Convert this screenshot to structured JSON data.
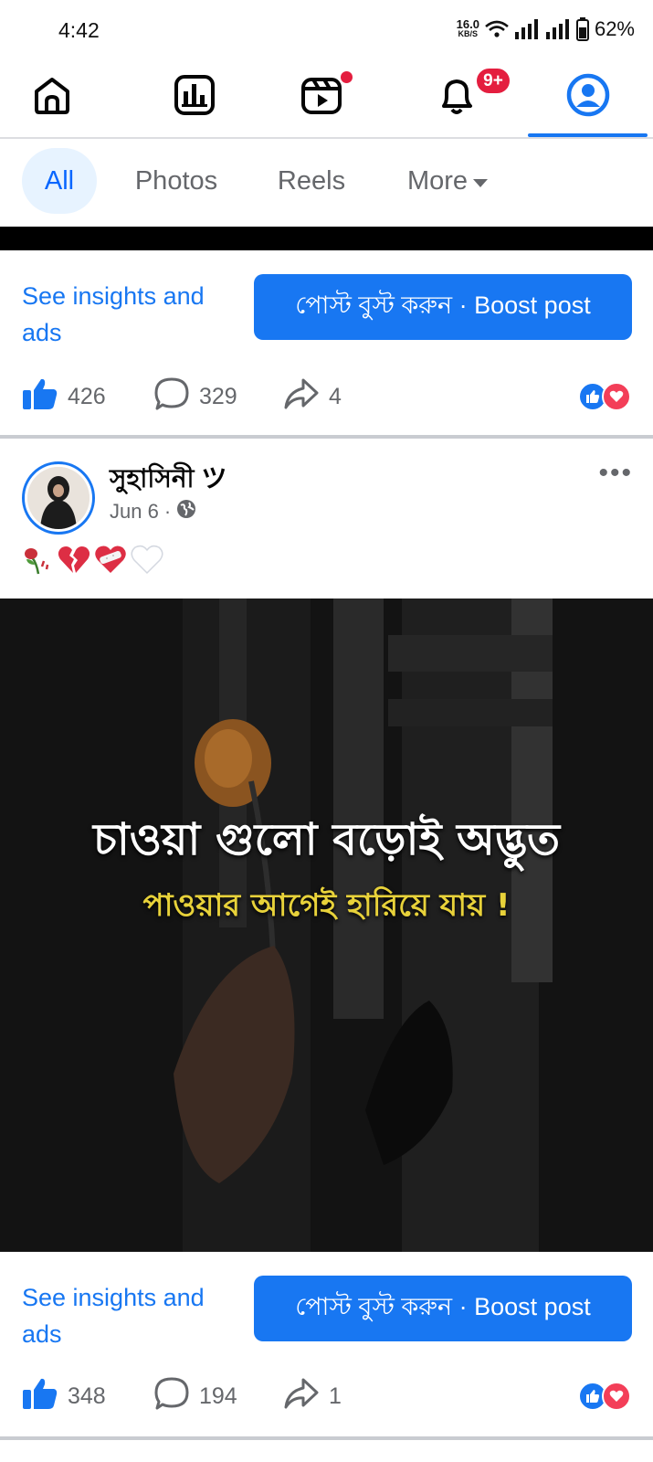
{
  "status_bar": {
    "time": "4:42",
    "net_speed_value": "16.0",
    "net_speed_unit": "KB/S",
    "battery_percent": "62%"
  },
  "top_nav": {
    "items": [
      "home-icon",
      "dashboard-icon",
      "video-icon",
      "notifications-icon",
      "profile-icon"
    ],
    "notification_badge": "9+",
    "active_item": "profile-icon",
    "accent_color": "#1877f2",
    "badge_color": "#e41e3f"
  },
  "filter_tabs": {
    "all": "All",
    "photos": "Photos",
    "reels": "Reels",
    "more": "More"
  },
  "post1": {
    "insights_link": "See insights and ads",
    "boost_button": "পোস্ট বুস্ট করুন · Boost post",
    "likes": "426",
    "comments": "329",
    "shares": "4"
  },
  "post2": {
    "author": "সুহাসিনী ツ",
    "date": "Jun 6 ·",
    "caption_emojis": [
      "wilted-rose",
      "broken-heart",
      "mending-heart",
      "white-heart"
    ],
    "image_text_line1": "চাওয়া গুলো বড়োই অদ্ভুত",
    "image_text_line2": "পাওয়ার আগেই হারিয়ে যায় !",
    "insights_link": "See insights and ads",
    "boost_button": "পোস্ট বুস্ট করুন · Boost post",
    "likes": "348",
    "comments": "194",
    "shares": "1"
  }
}
